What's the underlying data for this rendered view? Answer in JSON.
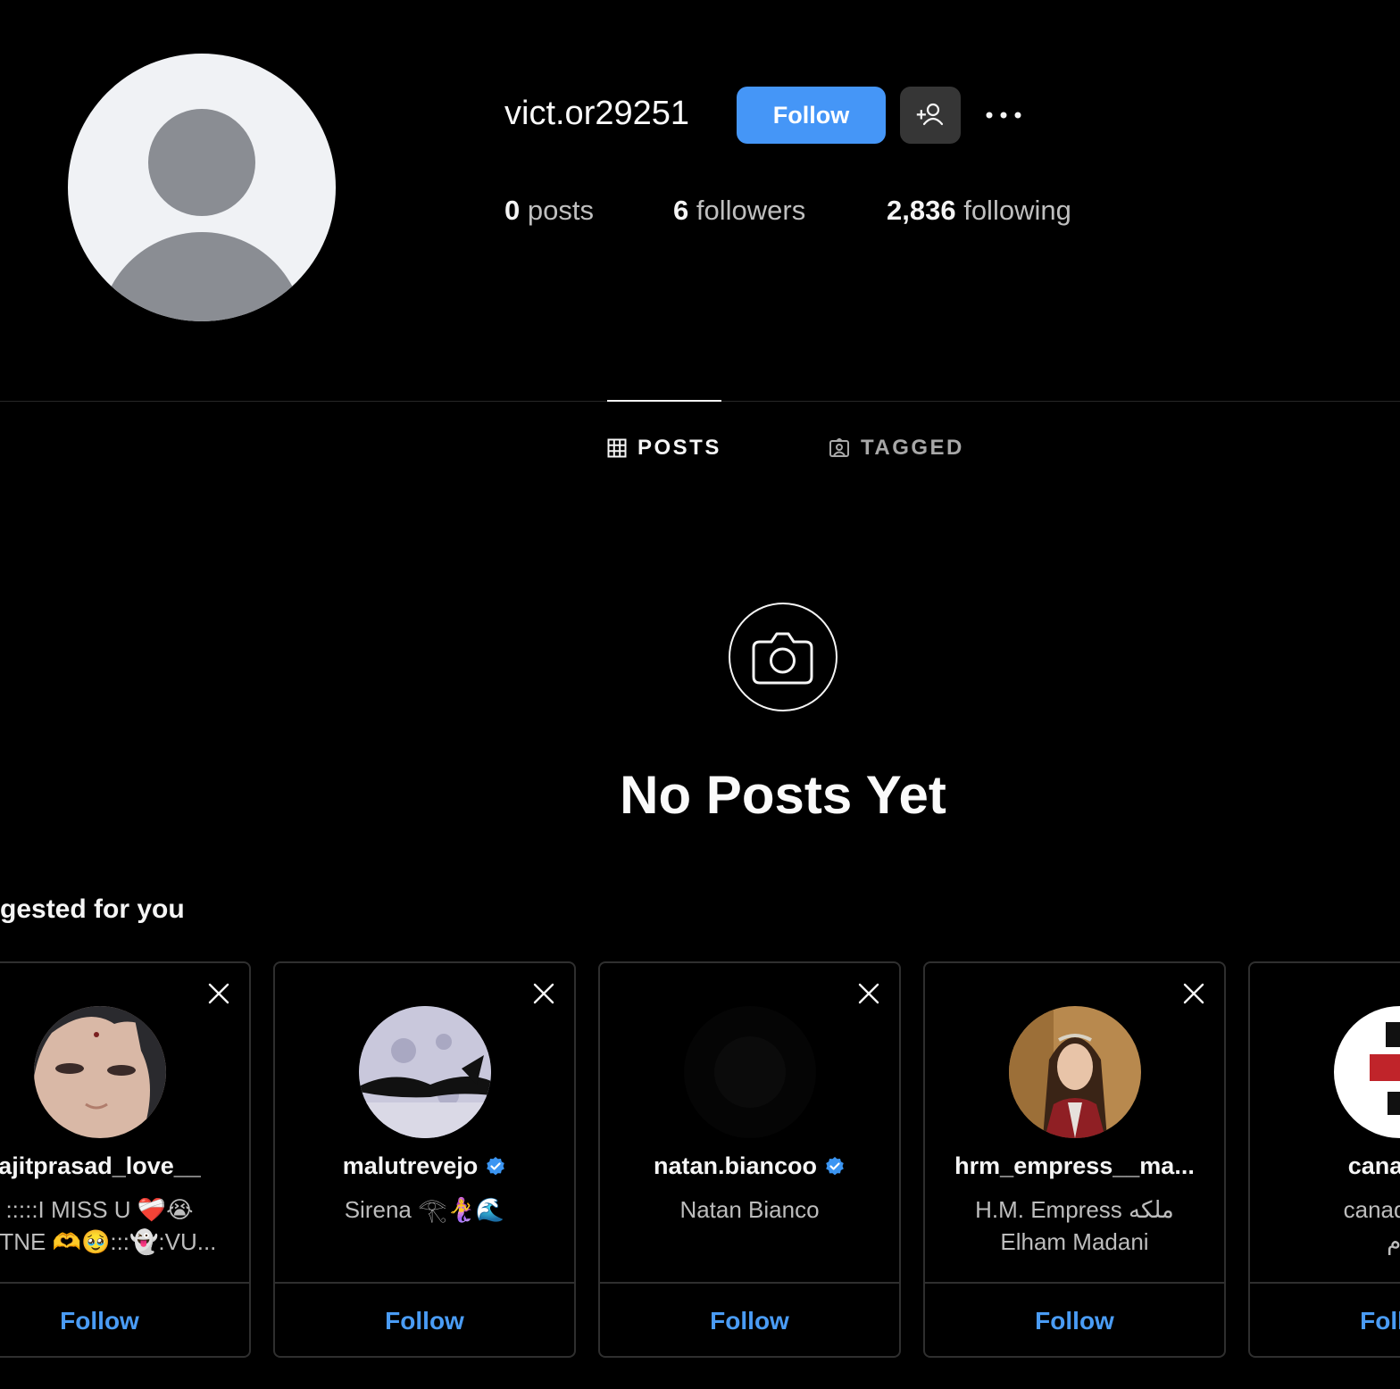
{
  "profile": {
    "username": "vict.or29251",
    "follow_label": "Follow",
    "stats": {
      "posts_count": "0",
      "posts_label": "posts",
      "followers_count": "6",
      "followers_label": "followers",
      "following_count": "2,836",
      "following_label": "following"
    }
  },
  "tabs": [
    {
      "label": "POSTS",
      "icon": "grid-icon",
      "active": true
    },
    {
      "label": "TAGGED",
      "icon": "tagged-icon",
      "active": false
    }
  ],
  "empty_state": {
    "title": "No Posts Yet",
    "icon": "camera-icon"
  },
  "suggestions": {
    "heading": "gested for you",
    "follow_label": "Follow",
    "cards": [
      {
        "username": "ajitprasad_love__",
        "subtitle_line1": ":::::I MISS U ❤️‍🩹😭",
        "subtitle_line2": "UTNE 🫶🥹:::👻:VU...",
        "verified": false
      },
      {
        "username": "malutrevejo",
        "subtitle_line1": "Sirena 𓂀🧜‍♀️🌊",
        "subtitle_line2": "",
        "verified": true
      },
      {
        "username": "natan.biancoo",
        "subtitle_line1": "Natan Bianco",
        "subtitle_line2": "",
        "verified": true
      },
      {
        "username": "hrm_empress__ma...",
        "subtitle_line1": "H.M. Empress ملکه",
        "subtitle_line2": "Elham Madani",
        "verified": false
      },
      {
        "username": "canadaal",
        "subtitle_line1": "canada aly",
        "subtitle_line2": "وم",
        "verified": false
      }
    ]
  },
  "colors": {
    "background": "#000000",
    "accent": "#4596f7",
    "link": "#4a9cf5"
  }
}
